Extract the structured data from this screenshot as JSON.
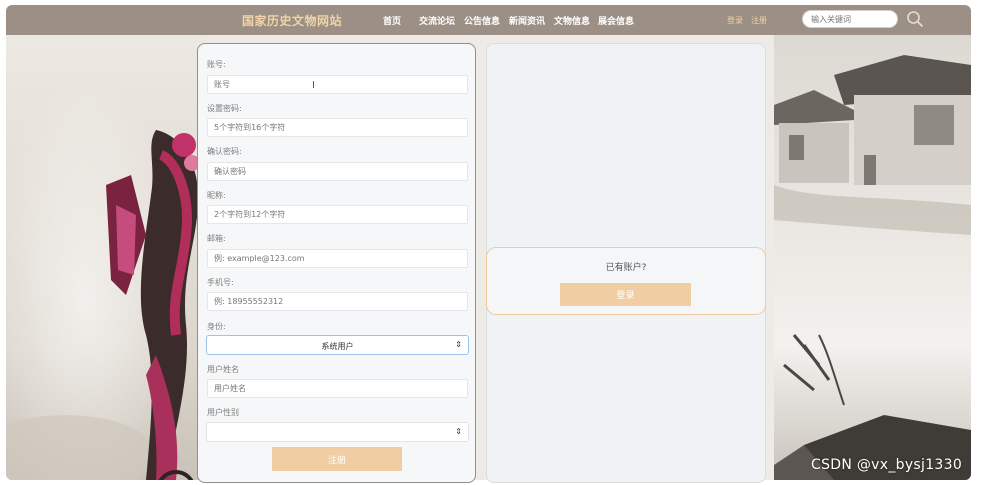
{
  "header": {
    "brand": "国家历史文物网站",
    "nav": [
      "首页",
      "交流论坛",
      "公告信息",
      "新闻资讯",
      "文物信息",
      "展会信息"
    ],
    "login_link": "登录",
    "register_link": "注册",
    "search_placeholder": "输入关键词"
  },
  "form": {
    "fields": [
      {
        "label": "账号:",
        "placeholder": "账号"
      },
      {
        "label": "设置密码:",
        "placeholder": "5个字符到16个字符"
      },
      {
        "label": "确认密码:",
        "placeholder": "确认密码"
      },
      {
        "label": "昵称:",
        "placeholder": "2个字符到12个字符"
      },
      {
        "label": "邮箱:",
        "placeholder": "例: example@123.com"
      },
      {
        "label": "手机号:",
        "placeholder": "例: 18955552312"
      }
    ],
    "role_label": "身份:",
    "role_value": "系统用户",
    "name_label": "用户姓名",
    "name_placeholder": "用户姓名",
    "gender_label": "用户性别",
    "gender_value": "",
    "register_button": "注册"
  },
  "side": {
    "has_account": "已有账户?",
    "login_button": "登录"
  },
  "watermark": "CSDN @vx_bysj1330",
  "colors": {
    "header_bg": "#9c8f86",
    "brand": "#f1d3a8",
    "button": "#f1cda3",
    "focus_border": "#9cc3ea"
  }
}
